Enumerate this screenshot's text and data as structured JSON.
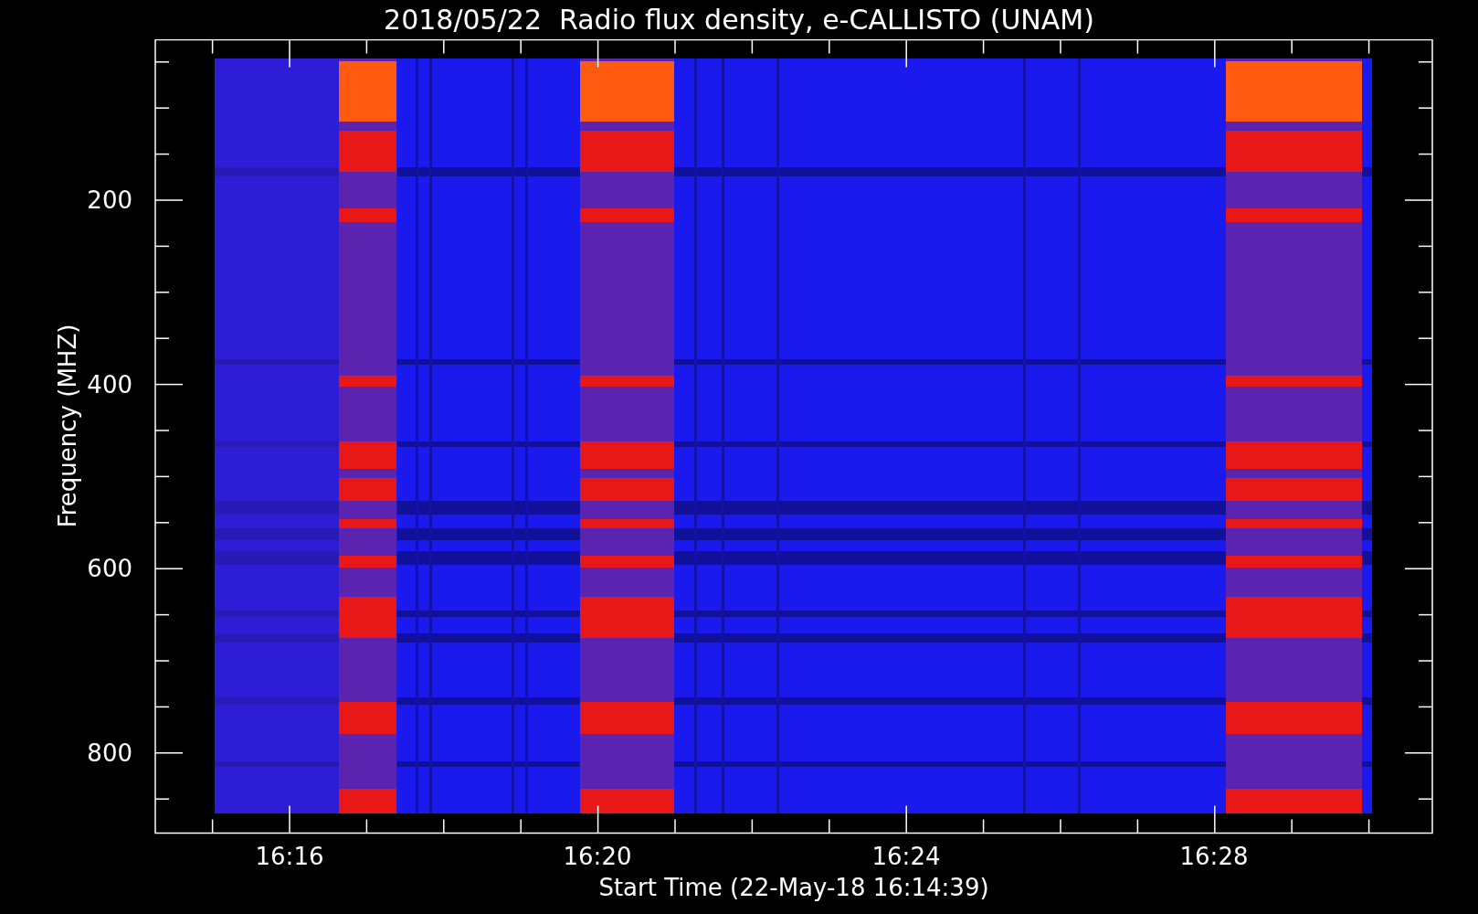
{
  "title": "2018/05/22  Radio flux density, e-CALLISTO (UNAM)",
  "y_axis": {
    "label": "Frequency (MHZ)",
    "ticks": [
      "200",
      "400",
      "600",
      "800"
    ]
  },
  "x_axis": {
    "label": "Start Time (22-May-18 16:14:39)",
    "ticks": [
      "16:16",
      "16:20",
      "16:24",
      "16:28"
    ]
  }
}
